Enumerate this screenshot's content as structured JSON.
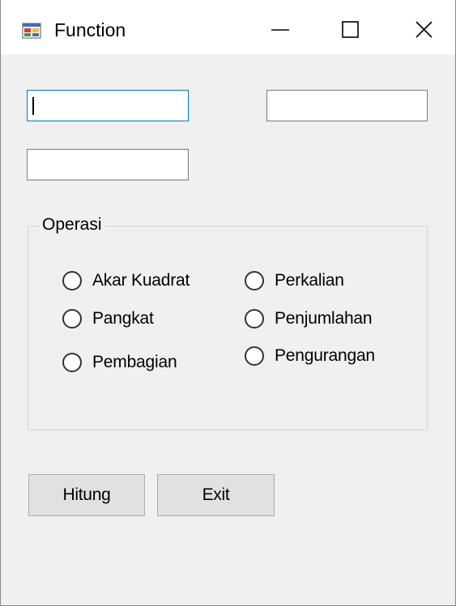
{
  "window": {
    "title": "Function",
    "app_icon": "winforms-app-icon",
    "controls": {
      "minimize_icon": "minimize-icon",
      "maximize_icon": "maximize-icon",
      "close_icon": "close-icon"
    }
  },
  "inputs": {
    "input1": {
      "value": "",
      "focused": true
    },
    "input2": {
      "value": ""
    },
    "input3": {
      "value": ""
    }
  },
  "operasi": {
    "label": "Operasi",
    "options": [
      {
        "label": "Akar Kuadrat",
        "checked": false
      },
      {
        "label": "Pangkat",
        "checked": false
      },
      {
        "label": "Pembagian",
        "checked": false
      },
      {
        "label": "Perkalian",
        "checked": false
      },
      {
        "label": "Penjumlahan",
        "checked": false
      },
      {
        "label": "Pengurangan",
        "checked": false
      }
    ]
  },
  "buttons": {
    "hitung": "Hitung",
    "exit": "Exit"
  },
  "colors": {
    "window_bg": "#f0f0f0",
    "titlebar_bg": "#ffffff",
    "focus_border": "#0078d7",
    "button_bg": "#e1e1e1"
  }
}
